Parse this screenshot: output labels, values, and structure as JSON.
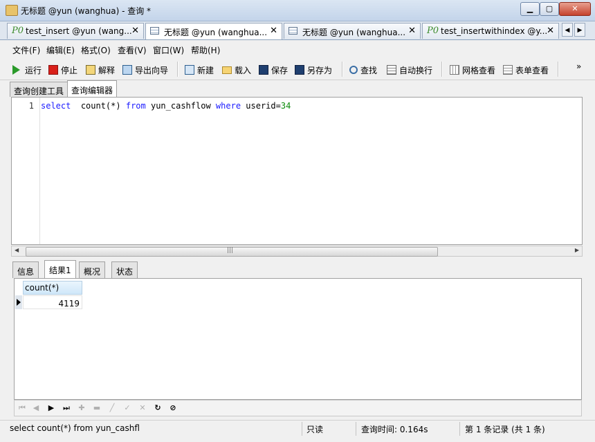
{
  "window": {
    "title": "无标题 @yun (wanghua) - 查询 *",
    "min": "▁",
    "max": "▢",
    "close": "✕"
  },
  "doc_tabs": [
    {
      "label": "test_insert @yun (wang...",
      "icon": "P0"
    },
    {
      "label": "无标题 @yun (wanghua...",
      "icon": ""
    },
    {
      "label": "无标题 @yun (wanghua...",
      "icon": ""
    },
    {
      "label": "test_insertwithindex @y...",
      "icon": "P0"
    }
  ],
  "menu": [
    "文件(F)",
    "编辑(E)",
    "格式(O)",
    "查看(V)",
    "窗口(W)",
    "帮助(H)"
  ],
  "toolbar": {
    "run": "运行",
    "stop": "停止",
    "explain": "解释",
    "export_wizard": "导出向导",
    "new": "新建",
    "load": "载入",
    "save": "保存",
    "save_as": "另存为",
    "find": "查找",
    "word_wrap": "自动换行",
    "grid_view": "网格查看",
    "form_view": "表单查看",
    "overflow": "»"
  },
  "sub_tabs": [
    "查询创建工具",
    "查询编辑器"
  ],
  "editor": {
    "line_number": "1",
    "tokens": [
      "select",
      "count(*)",
      "from",
      "yun_cashflow",
      "where",
      "userid=",
      "34"
    ]
  },
  "result_tabs": [
    "信息",
    "结果1",
    "概况",
    "状态"
  ],
  "result": {
    "column": "count(*)",
    "value": "4119"
  },
  "status": {
    "sql": "select  count(*) from yun_cashfl",
    "mode": "只读",
    "query_time": "查询时间: 0.164s",
    "records": "第 1 条记录 (共 1 条)"
  }
}
